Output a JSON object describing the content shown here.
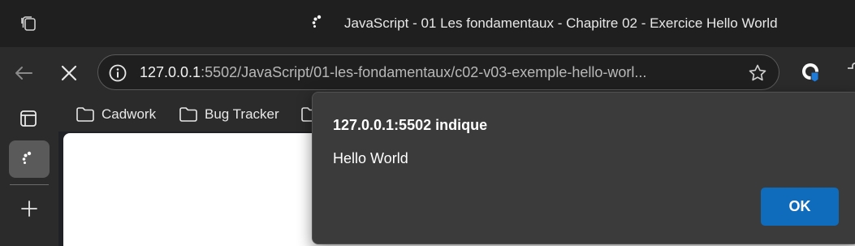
{
  "window": {
    "title": "JavaScript - 01 Les fondamentaux - Chapitre 02 - Exercice Hello World"
  },
  "toolbar": {
    "back_icon": "back-arrow-icon",
    "stop_icon": "stop-loading-icon",
    "address": {
      "host": "127.0.0.1",
      "rest": ":5502/JavaScript/01-les-fondamentaux/c02-v03-exemple-hello-worl..."
    },
    "site_info_icon": "site-info-icon",
    "favorite_icon": "star-icon"
  },
  "bookmarks": [
    {
      "label": "Cadwork",
      "icon": "folder-icon"
    },
    {
      "label": "Bug Tracker",
      "icon": "folder-icon"
    }
  ],
  "sidebar": {
    "panel_icon": "sidebar-panel-icon",
    "new_tab_icon": "plus-icon"
  },
  "dialog": {
    "title": "127.0.0.1:5502 indique",
    "message": "Hello World",
    "ok_label": "OK"
  },
  "colors": {
    "accent": "#0f6cbd",
    "dialog_bg": "#3b3b3b",
    "toolbar_bg": "#2b2b2b",
    "titlebar_bg": "#1f1f1f"
  }
}
